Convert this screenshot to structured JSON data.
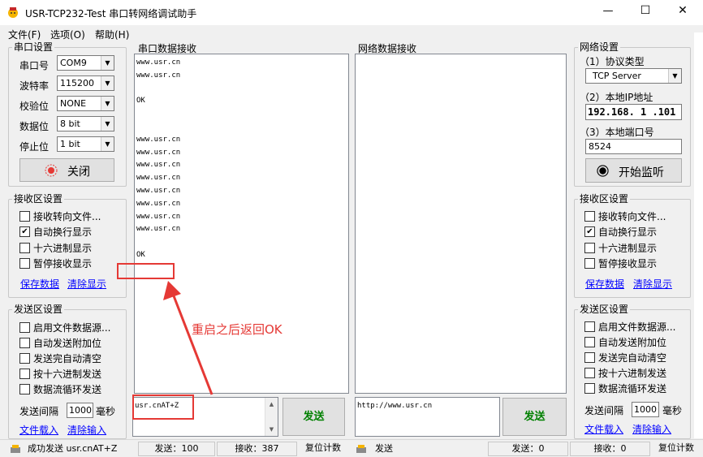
{
  "title_bar": {
    "title": "USR-TCP232-Test 串口转网络调试助手",
    "minimize": "—",
    "maximize": "☐",
    "close": "✕"
  },
  "menu": {
    "items": [
      {
        "label": "文件(F)"
      },
      {
        "label": "选项(O)"
      },
      {
        "label": "帮助(H)"
      }
    ]
  },
  "serial_settings": {
    "title": "串口设置",
    "fields": [
      {
        "label": "串口号",
        "value": "COM9"
      },
      {
        "label": "波特率",
        "value": "115200"
      },
      {
        "label": "校验位",
        "value": "NONE"
      },
      {
        "label": "数据位",
        "value": "8 bit"
      },
      {
        "label": "停止位",
        "value": "1 bit"
      }
    ],
    "close_button": "关闭"
  },
  "recv_settings_left": {
    "title": "接收区设置",
    "options": [
      {
        "label": "接收转向文件...",
        "checked": false
      },
      {
        "label": "自动换行显示",
        "checked": true
      },
      {
        "label": "十六进制显示",
        "checked": false
      },
      {
        "label": "暂停接收显示",
        "checked": false
      }
    ],
    "save_link": "保存数据",
    "clear_link": "清除显示"
  },
  "send_settings_left": {
    "title": "发送区设置",
    "options": [
      {
        "label": "启用文件数据源...",
        "checked": false
      },
      {
        "label": "自动发送附加位",
        "checked": false
      },
      {
        "label": "发送完自动清空",
        "checked": false
      },
      {
        "label": "按十六进制发送",
        "checked": false
      },
      {
        "label": "数据流循环发送",
        "checked": false
      }
    ],
    "interval_label": "发送间隔",
    "interval_value": "1000",
    "interval_unit": "毫秒",
    "file_link": "文件载入",
    "clear_link": "清除输入"
  },
  "serial_recv": {
    "title": "串口数据接收",
    "lines": [
      "www.usr.cn",
      "www.usr.cn",
      "",
      "OK",
      "",
      "",
      "www.usr.cn",
      "www.usr.cn",
      "www.usr.cn",
      "www.usr.cn",
      "www.usr.cn",
      "www.usr.cn",
      "www.usr.cn",
      "www.usr.cn",
      "",
      "OK"
    ]
  },
  "net_recv": {
    "title": "网络数据接收"
  },
  "serial_send": {
    "input_value": "usr.cnAT+Z",
    "send_button": "发送"
  },
  "net_send": {
    "input_value": "http://www.usr.cn",
    "send_button": "发送"
  },
  "annotation": {
    "text": "重启之后返回OK"
  },
  "net_settings": {
    "title": "网络设置",
    "protocol_label": "（1）协议类型",
    "protocol_value": "TCP Server",
    "ip_label": "（2）本地IP地址",
    "ip_value": "192.168. 1 .101",
    "port_label": "（3）本地端口号",
    "port_value": "8524",
    "listen_button": "开始监听"
  },
  "recv_settings_right": {
    "title": "接收区设置",
    "options": [
      {
        "label": "接收转向文件...",
        "checked": false
      },
      {
        "label": "自动换行显示",
        "checked": true
      },
      {
        "label": "十六进制显示",
        "checked": false
      },
      {
        "label": "暂停接收显示",
        "checked": false
      }
    ],
    "save_link": "保存数据",
    "clear_link": "清除显示"
  },
  "send_settings_right": {
    "title": "发送区设置",
    "options": [
      {
        "label": "启用文件数据源...",
        "checked": false
      },
      {
        "label": "自动发送附加位",
        "checked": false
      },
      {
        "label": "发送完自动清空",
        "checked": false
      },
      {
        "label": "按十六进制发送",
        "checked": false
      },
      {
        "label": "数据流循环发送",
        "checked": false
      }
    ],
    "interval_label": "发送间隔",
    "interval_value": "1000",
    "interval_unit": "毫秒",
    "file_link": "文件载入",
    "clear_link": "清除输入"
  },
  "status_bar": {
    "left_status": "成功发送 usr.cnAT+Z",
    "left_sent": "发送：100",
    "left_recv": "接收：387",
    "left_reset": "复位计数",
    "right_status": "发送",
    "right_sent": "发送：0",
    "right_recv": "接收：0",
    "right_reset": "复位计数"
  },
  "colors": {
    "annotation_red": "#e53935",
    "link_blue": "#0000ff",
    "send_green": "#008000"
  }
}
